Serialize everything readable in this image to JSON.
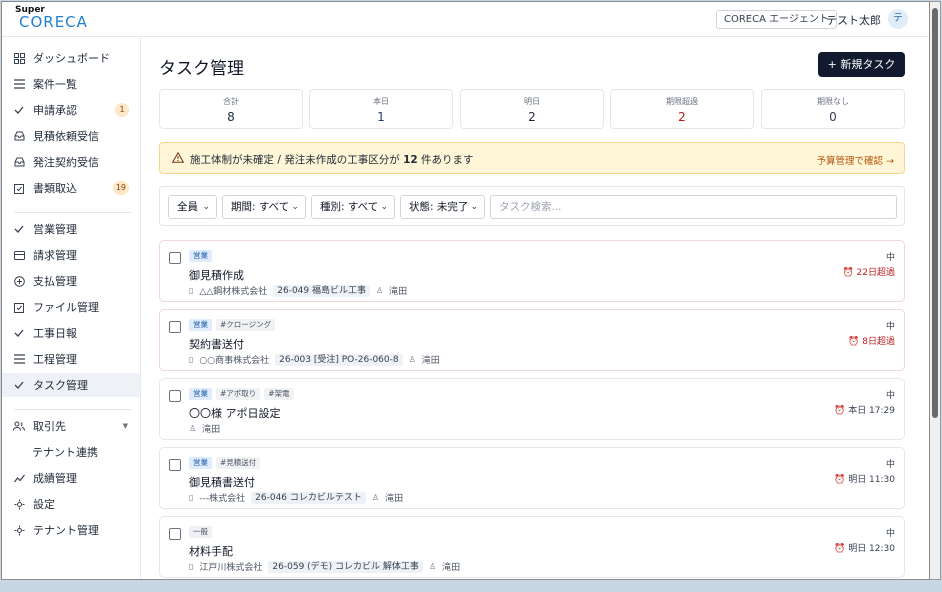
{
  "header": {
    "logo_small": "Super",
    "logo_main": "CORECA",
    "agent_button": "CORECA エージェント",
    "user_name": "テスト太郎",
    "avatar_initial": "テ"
  },
  "sidebar": {
    "items": [
      {
        "label": "ダッシュボード"
      },
      {
        "label": "案件一覧"
      },
      {
        "label": "申請承認",
        "badge": "1"
      },
      {
        "label": "見積依頼受信"
      },
      {
        "label": "発注契約受信"
      },
      {
        "label": "書類取込",
        "badge": "19"
      },
      {
        "label": "営業管理"
      },
      {
        "label": "請求管理"
      },
      {
        "label": "支払管理"
      },
      {
        "label": "ファイル管理"
      },
      {
        "label": "工事日報"
      },
      {
        "label": "工程管理"
      },
      {
        "label": "タスク管理"
      },
      {
        "label": "取引先"
      },
      {
        "label": "テナント連携"
      },
      {
        "label": "成績管理"
      },
      {
        "label": "設定"
      },
      {
        "label": "テナント管理"
      }
    ]
  },
  "main": {
    "title": "タスク管理",
    "new_task_button": "+ 新規タスク",
    "stats": [
      {
        "label": "合計",
        "value": "8"
      },
      {
        "label": "本日",
        "value": "1"
      },
      {
        "label": "明日",
        "value": "2"
      },
      {
        "label": "期限超過",
        "value": "2"
      },
      {
        "label": "期限なし",
        "value": "0"
      }
    ],
    "alert": {
      "prefix": "施工体制が未確定 / 発注未作成の工事区分が",
      "count": "12",
      "suffix": "件あります",
      "link": "予算管理で確認 →"
    },
    "filters": {
      "assignee": "全員",
      "period": "期間: すべて",
      "type": "種別: すべて",
      "status": "状態: 未完了",
      "search_placeholder": "タスク検索..."
    },
    "tasks": [
      {
        "tags": [
          "営業"
        ],
        "title": "御見積作成",
        "company": "△△鋼材株式会社",
        "project": "26-049 福島ビル工事",
        "assignee": "滝田",
        "priority": "中",
        "due": "22日超過"
      },
      {
        "tags": [
          "営業",
          "#クロージング"
        ],
        "title": "契約書送付",
        "company": "○○商事株式会社",
        "project": "26-003 [受注] PO-26-060-8",
        "assignee": "滝田",
        "priority": "中",
        "due": "8日超過"
      },
      {
        "tags": [
          "営業",
          "#アポ取り",
          "#架電"
        ],
        "title": "〇〇様 アポ日設定",
        "company": "",
        "project": "",
        "assignee": "滝田",
        "priority": "中",
        "due": "本日 17:29"
      },
      {
        "tags": [
          "営業",
          "#見積送付"
        ],
        "title": "御見積書送付",
        "company": "---株式会社",
        "project": "26-046 コレカビルテスト",
        "assignee": "滝田",
        "priority": "中",
        "due": "明日 11:30"
      },
      {
        "tags": [
          "一般"
        ],
        "title": "材料手配",
        "company": "江戸川株式会社",
        "project": "26-059 (デモ) コレカビル 解体工事",
        "assignee": "滝田",
        "priority": "中",
        "due": "明日 12:30"
      }
    ]
  }
}
